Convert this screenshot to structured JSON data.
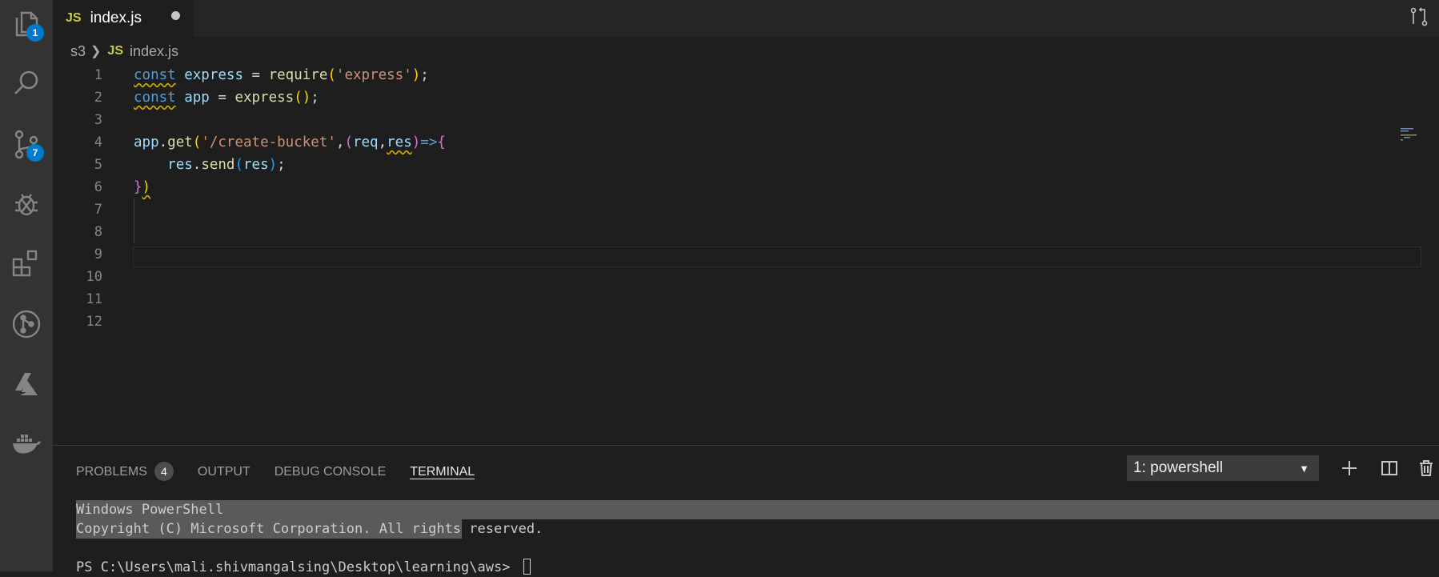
{
  "activity_bar": {
    "items": [
      {
        "name": "explorer",
        "icon": "files-icon",
        "badge": "1"
      },
      {
        "name": "search",
        "icon": "search-icon",
        "badge": ""
      },
      {
        "name": "source-control",
        "icon": "source-control-icon",
        "badge": "7"
      },
      {
        "name": "debug",
        "icon": "debug-icon",
        "badge": ""
      },
      {
        "name": "extensions",
        "icon": "extensions-icon",
        "badge": ""
      },
      {
        "name": "git-graph",
        "icon": "git-icon",
        "badge": ""
      },
      {
        "name": "azure",
        "icon": "azure-icon",
        "badge": ""
      },
      {
        "name": "docker",
        "icon": "docker-icon",
        "badge": ""
      }
    ]
  },
  "tab": {
    "lang_badge": "JS",
    "filename": "index.js"
  },
  "breadcrumb": {
    "folder": "s3",
    "lang_badge": "JS",
    "file": "index.js"
  },
  "editor": {
    "line_numbers": [
      "1",
      "2",
      "3",
      "4",
      "5",
      "6",
      "7",
      "8",
      "9",
      "10",
      "11",
      "12"
    ],
    "lines": [
      "const express = require('express');",
      "const app = express();",
      "",
      "app.get('/create-bucket',(req,res)=>{",
      "    res.send(res);",
      "})",
      "",
      "",
      "",
      "",
      "",
      ""
    ]
  },
  "panel": {
    "tabs": [
      "PROBLEMS",
      "OUTPUT",
      "DEBUG CONSOLE",
      "TERMINAL"
    ],
    "problems_count": "4",
    "active_tab": "TERMINAL",
    "terminal_select": "1: powershell"
  },
  "terminal": {
    "lines": [
      "Windows PowerShell",
      "Copyright (C) Microsoft Corporation. All rights reserved.",
      "",
      "PS C:\\Users\\mali.shivmangalsing\\Desktop\\learning\\aws> "
    ]
  },
  "colors": {
    "accent": "#007acc",
    "js_badge": "#cbcb41"
  }
}
